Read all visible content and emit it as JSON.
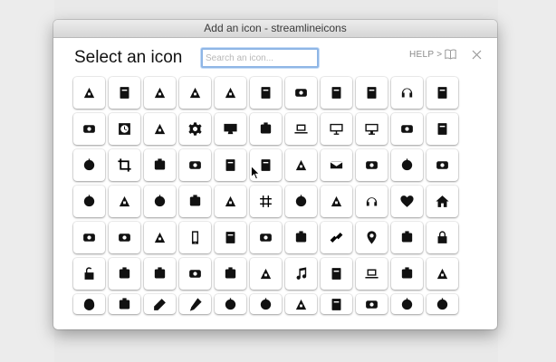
{
  "window": {
    "title": "Add an icon - streamlineicons"
  },
  "dialog": {
    "heading": "Select an icon",
    "search_placeholder": "Search an icon...",
    "help_label": "HELP >"
  },
  "icons": [
    "bellboy-icon",
    "bomb-icon",
    "open-book-icon",
    "briefcase-icon",
    "chat-bubble-icon",
    "speech-bubble-icon",
    "game-console-icon",
    "scanner-icon",
    "video-camera-icon",
    "headphones-support-icon",
    "bowler-hat-icon",
    "chef-hat-icon",
    "clock-icon",
    "copier-icon",
    "gear-icon",
    "monitor-icon",
    "chat-bubbles-icon",
    "laptop-icon",
    "desktop-icon",
    "imac-icon",
    "notebook-icon",
    "document-clock-icon",
    "blender-icon",
    "crop-icon",
    "crown-icon",
    "pens-cup-icon",
    "gamepad-icon",
    "cocktail-icon",
    "coffee-cup-icon",
    "envelope-icon",
    "book-cover-icon",
    "feather-quill-icon",
    "fork-knife-icon",
    "forklift-icon",
    "pen-nib-icon",
    "fountain-pen-icon",
    "speedometer-icon",
    "globe-stand-icon",
    "hashtag-icon",
    "baby-stroller-icon",
    "handbag-icon",
    "headphones-icon",
    "heart-icon",
    "home-icon",
    "hotdog-icon",
    "popsicle-icon",
    "picture-icon",
    "smartphone-icon",
    "ipod-icon",
    "photo-gallery-icon",
    "image-stack-icon",
    "chain-link-icon",
    "map-pin-icon",
    "location-person-icon",
    "padlock-icon",
    "unlock-icon",
    "magic-wand-icon",
    "magnet-icon",
    "microphone-icon",
    "mustache-icon",
    "audio-player-icon",
    "music-note-icon",
    "typewriter-icon",
    "laptop-open-icon",
    "paint-brush-icon",
    "paint-bucket-icon",
    "mouse-icon",
    "paint-roller-icon",
    "pencil-icon",
    "pen-icon",
    "lipstick-icon",
    "easel-icon",
    "brush-icon",
    "headset-icon",
    "bottle-icon",
    "picture-frame-icon",
    "pestle-icon"
  ]
}
